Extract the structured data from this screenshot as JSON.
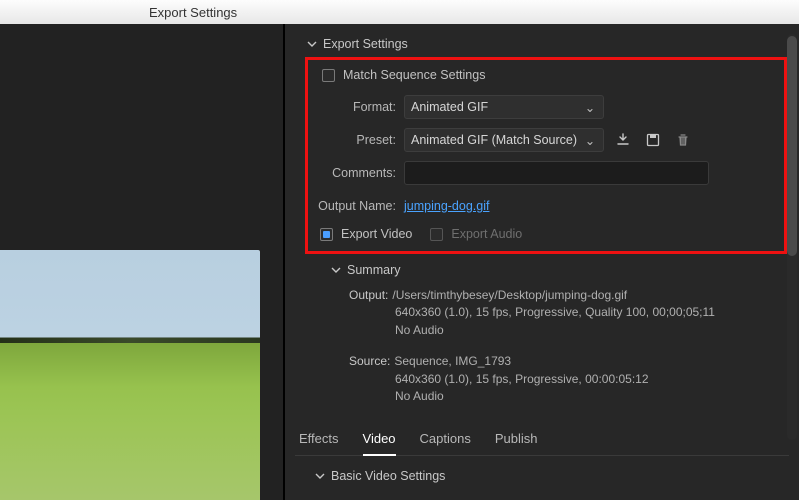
{
  "window": {
    "title": "Export Settings"
  },
  "sections": {
    "export_settings": {
      "title": "Export Settings"
    },
    "summary": {
      "title": "Summary"
    },
    "basic_video": {
      "title": "Basic Video Settings"
    }
  },
  "match_sequence": {
    "label": "Match Sequence Settings",
    "checked": false
  },
  "format": {
    "label": "Format:",
    "value": "Animated GIF"
  },
  "preset": {
    "label": "Preset:",
    "value": "Animated GIF (Match Source)"
  },
  "comments": {
    "label": "Comments:",
    "value": ""
  },
  "output_name": {
    "label": "Output Name:",
    "value": "jumping-dog.gif"
  },
  "export_video": {
    "label": "Export Video",
    "checked": true
  },
  "export_audio": {
    "label": "Export Audio",
    "checked": false
  },
  "summary": {
    "output_label": "Output:",
    "output_path": "/Users/timthybesey/Desktop/jumping-dog.gif",
    "output_specs": "640x360 (1.0), 15 fps, Progressive, Quality 100, 00;00;05;11",
    "output_audio": "No Audio",
    "source_label": "Source:",
    "source_name": "Sequence, IMG_1793",
    "source_specs": "640x360 (1.0), 15 fps, Progressive, 00:00:05:12",
    "source_audio": "No Audio"
  },
  "tabs": {
    "effects": "Effects",
    "video": "Video",
    "captions": "Captions",
    "publish": "Publish",
    "active": "video"
  },
  "icons": {
    "import": "import-preset-icon",
    "save": "save-preset-icon",
    "delete": "delete-preset-icon"
  }
}
